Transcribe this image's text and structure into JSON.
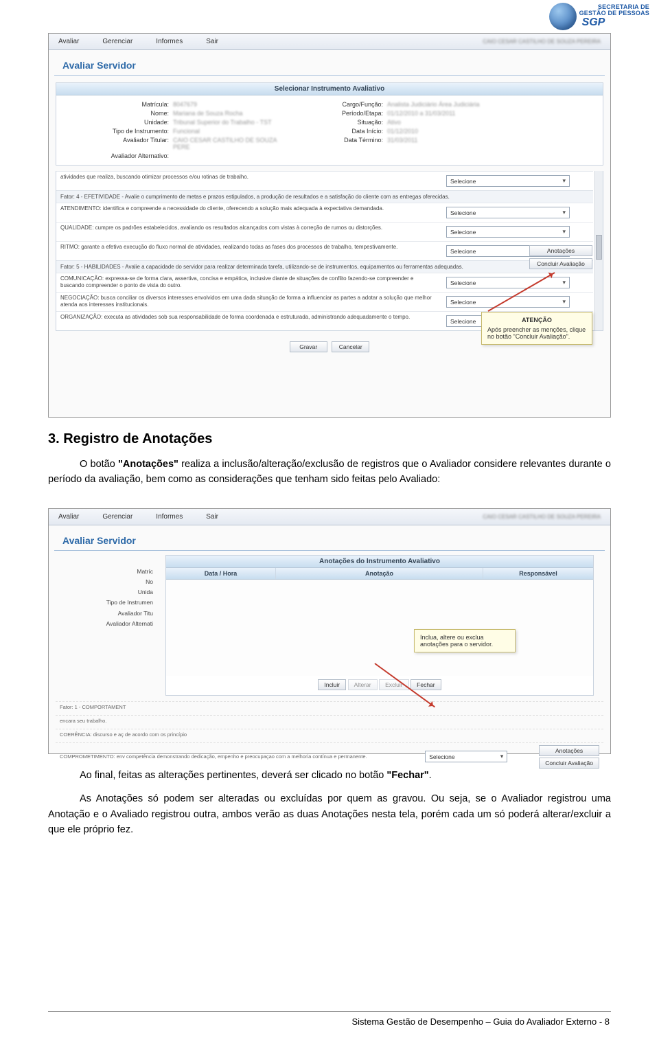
{
  "logo": {
    "line1": "SECRETARIA DE",
    "line2": "GESTÃO DE PESSOAS",
    "acronym": "SGP"
  },
  "shot1": {
    "menu": {
      "avaliar": "Avaliar",
      "gerenciar": "Gerenciar",
      "informes": "Informes",
      "sair": "Sair",
      "username": "CAIO CESAR CASTILHO DE SOUZA PEREIRA"
    },
    "title": "Avaliar Servidor",
    "panel_title": "Selecionar Instrumento Avaliativo",
    "fields": {
      "matricula_l": "Matrícula:",
      "matricula_v": "8047679",
      "cargo_l": "Cargo/Função:",
      "cargo_v": "Analista Judiciário Área Judiciária",
      "nome_l": "Nome:",
      "nome_v": "Mariana de Souza Rocha",
      "periodo_l": "Período/Etapa:",
      "periodo_v": "01/12/2010 a 31/03/2011",
      "unidade_l": "Unidade:",
      "unidade_v": "Tribunal Superior do Trabalho - TST",
      "situacao_l": "Situação:",
      "situacao_v": "Ativo",
      "tipo_l": "Tipo de Instrumento:",
      "tipo_v": "Funcional",
      "dtini_l": "Data Início:",
      "dtini_v": "01/12/2010",
      "avtit_l": "Avaliador Titular:",
      "avtit_v": "CAIO CESAR CASTILHO DE SOUZA PERE",
      "dtterm_l": "Data Término:",
      "dtterm_v": "31/03/2011",
      "avalt_l": "Avaliador Alternativo:"
    },
    "rows": {
      "r0": "atividades que realiza, buscando otimizar processos e/ou rotinas de trabalho.",
      "f4": "Fator: 4 - EFETIVIDADE - Avalie o cumprimento de metas e prazos estipulados, a produção de resultados e a satisfação do cliente com as entregas oferecidas.",
      "r1": "ATENDIMENTO: identifica e compreende a necessidade do cliente, oferecendo a solução mais adequada à expectativa demandada.",
      "r2": "QUALIDADE: cumpre os padrões estabelecidos, avaliando os resultados alcançados com vistas à correção de rumos ou distorções.",
      "r3": "RITMO: garante a efetiva execução do fluxo normal de atividades, realizando todas as fases dos processos de trabalho, tempestivamente.",
      "f5": "Fator: 5 - HABILIDADES - Avalie a capacidade do servidor para realizar determinada tarefa, utilizando-se de instrumentos, equipamentos ou ferramentas adequadas.",
      "r4": "COMUNICAÇÃO: expressa-se de forma clara, assertiva, concisa e empática, inclusive diante de situações de conflito fazendo-se compreender e buscando compreender o ponto de vista do outro.",
      "r5": "NEGOCIAÇÃO: busca conciliar os diversos interesses envolvidos em uma dada situação de forma a influenciar as partes a adotar a solução que melhor atenda aos interesses institucionais.",
      "r6": "ORGANIZAÇÃO: executa as atividades sob sua responsabilidade de forma coordenada e estruturada, administrando adequadamente o tempo."
    },
    "select_placeholder": "Selecione",
    "side": {
      "anotacoes": "Anotações",
      "concluir": "Concluir Avaliação"
    },
    "callout": {
      "title": "ATENÇÃO",
      "body": "Após preencher as menções, clique no botão \"Concluir Avaliação\"."
    },
    "bottom": {
      "gravar": "Gravar",
      "cancelar": "Cancelar"
    }
  },
  "section": {
    "heading": "3. Registro de Anotações",
    "p1a": "O botão ",
    "p1b": "\"Anotações\"",
    "p1c": " realiza a inclusão/alteração/exclusão de registros que o Avaliador considere relevantes durante o período da avaliação, bem como as considerações que tenham sido feitas pelo Avaliado:"
  },
  "shot2": {
    "panel_title": "Anotações do Instrumento Avaliativo",
    "cols": {
      "c1": "Data / Hora",
      "c2": "Anotação",
      "c3": "Responsável"
    },
    "left_labels": {
      "l1": "Matríc",
      "l2": "No",
      "l3": "Unida",
      "l4": "Tipo de Instrumen",
      "l5": "Avaliador Titu",
      "l6": "Avaliador Alternati"
    },
    "callout": "Inclua, altere ou exclua anotações para o servidor.",
    "btns": {
      "incluir": "Incluir",
      "alterar": "Alterar",
      "excluir": "Excluir",
      "fechar": "Fechar"
    },
    "bottom": {
      "f1": "Fator: 1 - COMPORTAMENT",
      "r1a": "encara seu trabalho.",
      "r2": "COERÊNCIA: discurso e aç de acordo com os princípio",
      "r3": "COMPROMETIMENTO: env competência demonstrando dedicação, empenho e preocupaçao com a melhoria contínua e permanente.",
      "sel": "Selecione",
      "anot": "Anotações",
      "conc": "Concluir Avaliação"
    }
  },
  "p2": {
    "a": "Ao final, feitas as alterações pertinentes, deverá ser clicado no botão ",
    "b": "\"Fechar\"",
    "c": "."
  },
  "p3": "As Anotações só podem ser alteradas ou excluídas por quem as gravou. Ou seja, se o Avaliador registrou uma Anotação e o Avaliado registrou outra, ambos verão as duas Anotações nesta tela, porém cada um só poderá alterar/excluir a que ele próprio fez.",
  "footer": "Sistema Gestão de Desempenho – Guia do Avaliador Externo - 8"
}
